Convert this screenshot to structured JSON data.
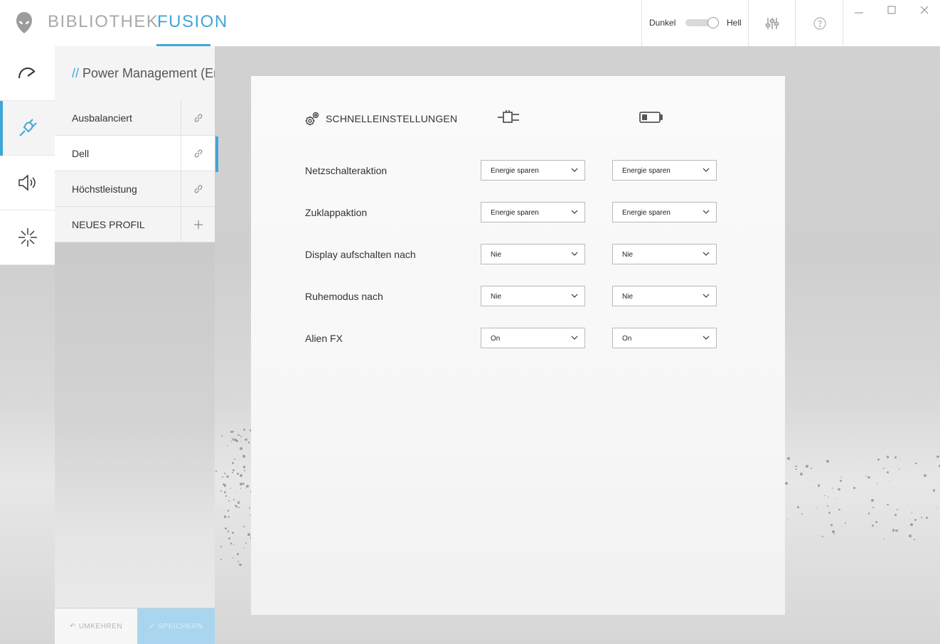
{
  "header": {
    "tabs": [
      {
        "label": "BIBLIOTHEK",
        "active": false
      },
      {
        "label": "FUSION",
        "active": true
      }
    ],
    "theme_toggle": {
      "left_label": "Dunkel",
      "right_label": "Hell",
      "value": "Hell"
    }
  },
  "rail": {
    "items": [
      "performance-gauge-icon",
      "power-plug-icon",
      "speaker-icon",
      "lighting-icon"
    ],
    "active_index": 1
  },
  "profiles": {
    "breadcrumb_prefix": "//",
    "breadcrumb": "Power Management (Energie",
    "items": [
      {
        "label": "Ausbalanciert",
        "action_icon": "link-icon"
      },
      {
        "label": "Dell",
        "action_icon": "link-icon",
        "selected": true
      },
      {
        "label": "Höchstleistung",
        "action_icon": "link-icon"
      },
      {
        "label": "NEUES PROFIL",
        "action_icon": "plus-icon"
      }
    ],
    "revert_label": "UMKEHREN",
    "save_label": "SPEICHERN"
  },
  "quick_settings": {
    "title": "SCHNELLEINSTELLUNGEN",
    "columns": [
      "plugged-in-icon",
      "battery-icon"
    ],
    "rows": [
      {
        "label": "Netzschalteraktion",
        "ac": "Energie sparen",
        "dc": "Energie sparen"
      },
      {
        "label": "Zuklappaktion",
        "ac": "Energie sparen",
        "dc": "Energie sparen"
      },
      {
        "label": "Display aufschalten nach",
        "ac": "Nie",
        "dc": "Nie"
      },
      {
        "label": "Ruhemodus nach",
        "ac": "Nie",
        "dc": "Nie"
      },
      {
        "label": "Alien FX",
        "ac": "On",
        "dc": "On"
      }
    ]
  },
  "colors": {
    "accent": "#3fa6d8",
    "save_button": "#a9d6ee"
  }
}
